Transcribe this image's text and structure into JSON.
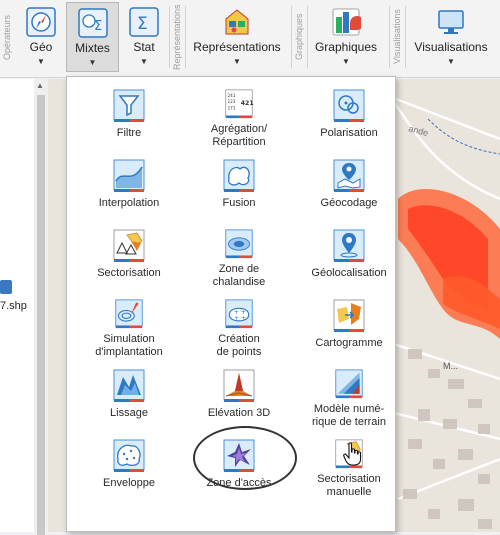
{
  "ribbon": {
    "groups": {
      "operateurs": "Opérateurs",
      "representations": "Représentations",
      "graphiques": "Graphiques",
      "visualisations": "Visualisations"
    },
    "buttons": {
      "geo": "Géo",
      "mixtes": "Mixtes",
      "stat": "Stat",
      "representations": "Représentations",
      "graphiques": "Graphiques",
      "visualisations": "Visualisations"
    }
  },
  "sidebar": {
    "file_name": "7.shp"
  },
  "map": {
    "street_label": "ande",
    "place_label": "M..."
  },
  "menu": {
    "items": [
      {
        "label": "Filtre",
        "icon": "filter-icon"
      },
      {
        "label": "Agrégation/\nRépartition",
        "icon": "aggregation-icon"
      },
      {
        "label": "Polarisation",
        "icon": "polarisation-icon"
      },
      {
        "label": "Interpolation",
        "icon": "interpolation-icon"
      },
      {
        "label": "Fusion",
        "icon": "fusion-icon"
      },
      {
        "label": "Géocodage",
        "icon": "geocoding-icon"
      },
      {
        "label": "Sectorisation",
        "icon": "sectorisation-icon"
      },
      {
        "label": "Zone de\nchalandise",
        "icon": "catchment-area-icon"
      },
      {
        "label": "Géolocalisation",
        "icon": "geolocation-icon"
      },
      {
        "label": "Simulation\nd'implantation",
        "icon": "simulation-icon"
      },
      {
        "label": "Création\nde points",
        "icon": "create-points-icon"
      },
      {
        "label": "Cartogramme",
        "icon": "cartogram-icon"
      },
      {
        "label": "Lissage",
        "icon": "smoothing-icon"
      },
      {
        "label": "Elévation 3D",
        "icon": "elevation-3d-icon"
      },
      {
        "label": "Modèle numé-\nrique de terrain",
        "icon": "terrain-model-icon"
      },
      {
        "label": "Enveloppe",
        "icon": "envelope-icon"
      },
      {
        "label": "Zone d'accès",
        "icon": "access-zone-icon"
      },
      {
        "label": "Sectorisation\nmanuelle",
        "icon": "manual-sectorisation-icon"
      }
    ]
  },
  "colors": {
    "accent_blue": "#2f78c4",
    "tile_red": "#e04b3c",
    "highlight_red": "#ff3b1f"
  }
}
